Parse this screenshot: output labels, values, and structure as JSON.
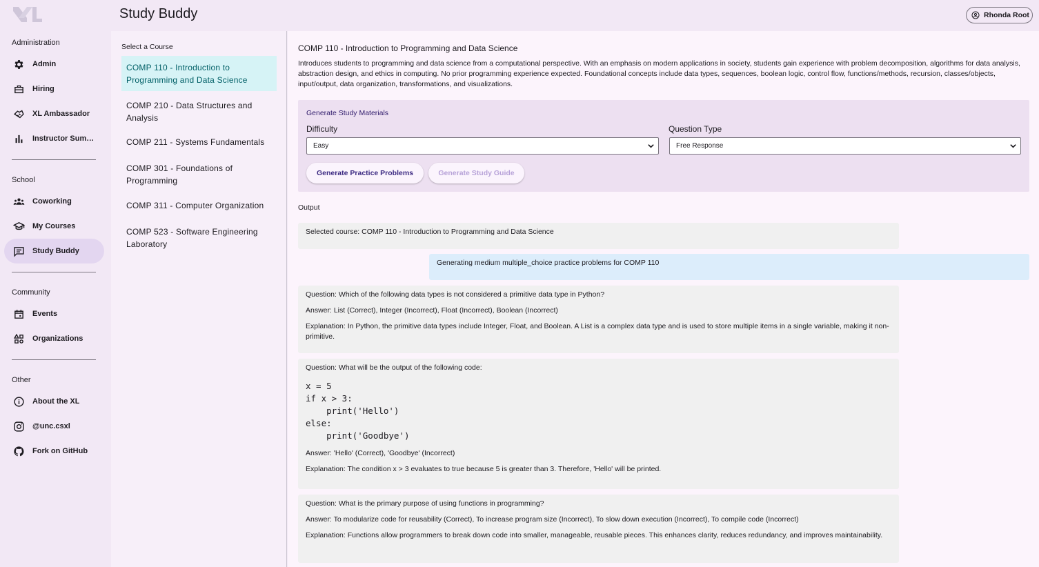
{
  "app": {
    "title": "Study Buddy"
  },
  "user": {
    "name": "Rhonda Root"
  },
  "nav": {
    "sections": [
      {
        "title": "Administration",
        "items": [
          "Admin",
          "Hiring",
          "XL Ambassador",
          "Instructor Summ..."
        ]
      },
      {
        "title": "School",
        "items": [
          "Coworking",
          "My Courses",
          "Study Buddy"
        ]
      },
      {
        "title": "Community",
        "items": [
          "Events",
          "Organizations"
        ]
      },
      {
        "title": "Other",
        "items": [
          "About the XL",
          "@unc.csxl",
          "Fork on GitHub"
        ]
      }
    ],
    "active": "Study Buddy",
    "icons": {
      "Admin": "gear-icon",
      "Hiring": "briefcase-icon",
      "XL Ambassador": "handshake-icon",
      "Instructor Summ...": "bar-chart-icon",
      "Coworking": "groups-icon",
      "My Courses": "school-icon",
      "Study Buddy": "chat-icon",
      "Events": "calendar-icon",
      "Organizations": "category-icon",
      "About the XL": "info-icon",
      "@unc.csxl": "instagram-icon",
      "Fork on GitHub": "github-icon"
    }
  },
  "courses": {
    "title": "Select a Course",
    "items": [
      "COMP 110 - Introduction to Programming and Data Science",
      "COMP 210 - Data Structures and Analysis",
      "COMP 211 - Systems Fundamentals",
      "COMP 301 - Foundations of Programming",
      "COMP 311 - Computer Organization",
      "COMP 523 - Software Engineering Laboratory"
    ],
    "selected_index": 0
  },
  "main": {
    "course_heading": "COMP 110 - Introduction to Programming and Data Science",
    "course_description": "Introduces students to programming and data science from a computational perspective. With an emphasis on modern applications in society, students gain experience with problem decomposition, algorithms for data analysis, abstraction design, and ethics in computing. No prior programming experience expected. Foundational concepts include data types, sequences, boolean logic, control flow, functions/methods, recursion, classes/objects, input/output, data organization, transformations, and visualizations.",
    "generate": {
      "title": "Generate Study Materials",
      "difficulty_label": "Difficulty",
      "difficulty_value": "Easy",
      "question_type_label": "Question Type",
      "question_type_value": "Free Response",
      "practice_button": "Generate Practice Problems",
      "guide_button": "Generate Study Guide"
    },
    "output": {
      "label": "Output",
      "selected_course": "Selected course: COMP 110 - Introduction to Programming and Data Science",
      "status": "Generating medium multiple_choice practice problems for COMP 110",
      "questions": [
        {
          "question": "Question: Which of the following data types is not considered a primitive data type in Python?",
          "answer": "Answer: List (Correct), Integer (Incorrect), Float (Incorrect), Boolean (Incorrect)",
          "explanation": "Explanation: In Python, the primitive data types include Integer, Float, and Boolean. A List is a complex data type and is used to store multiple items in a single variable, making it non-primitive."
        },
        {
          "question": "Question: What will be the output of the following code:",
          "code": "x = 5\nif x > 3:\n    print('Hello')\nelse:\n    print('Goodbye')",
          "answer": "Answer: 'Hello' (Correct), 'Goodbye' (Incorrect)",
          "explanation": "Explanation: The condition x  >  3 evaluates to true because 5 is greater than 3. Therefore, 'Hello' will be printed."
        },
        {
          "question": "Question: What is the primary purpose of using functions in programming?",
          "answer": "Answer: To modularize code for reusability (Correct), To increase program size (Incorrect), To slow down execution (Incorrect), To compile code (Incorrect)",
          "explanation": "Explanation: Functions allow programmers to break down code into smaller, manageable, reusable pieces. This enhances clarity, reduces redundancy, and improves maintainability."
        }
      ]
    }
  },
  "colors": {
    "nav_bg": "#f2e8f5",
    "active_nav": "#e3d6f0",
    "selected_course_bg": "#d6f3f6",
    "selected_course_text": "#005f66",
    "card_bg": "#ede0f1",
    "user_message_bg": "#dcedfb",
    "system_message_bg": "#f0f0f0",
    "primary_button_text": "#3c2a82"
  }
}
